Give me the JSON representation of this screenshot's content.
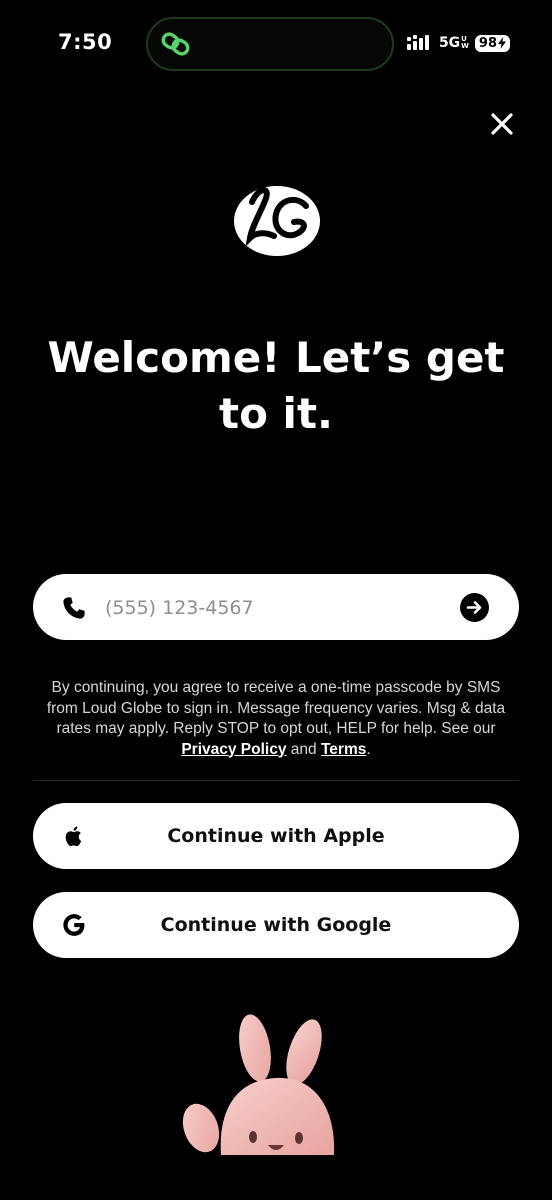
{
  "status_bar": {
    "time": "7:50",
    "network": "5G",
    "network_badge_top": "U",
    "network_badge_bottom": "W",
    "battery": "98"
  },
  "heading": {
    "line": "Welcome! Let’s get to it."
  },
  "phone_field": {
    "placeholder": "(555) 123-4567",
    "value": ""
  },
  "consent": {
    "text": "By continuing, you agree to receive a one-time passcode by SMS from Loud Globe to sign in. Message frequency varies. Msg & data rates may apply. Reply STOP to opt out, HELP for help. See our",
    "privacy_link": "Privacy Policy",
    "and": "and",
    "terms_link": "Terms",
    "end": "."
  },
  "buttons": {
    "apple": "Continue with Apple",
    "google": "Continue with Google"
  },
  "icons": {
    "close": "close-icon",
    "logo": "loud-globe-logo",
    "phone": "phone-icon",
    "submit": "arrow-right-icon",
    "apple": "apple-icon",
    "google": "google-icon",
    "island": "link-chain-icon"
  },
  "colors": {
    "background": "#000000",
    "island_accent": "#5bd36a",
    "button_bg": "#ffffff",
    "mascot": "#f2b9b5"
  }
}
